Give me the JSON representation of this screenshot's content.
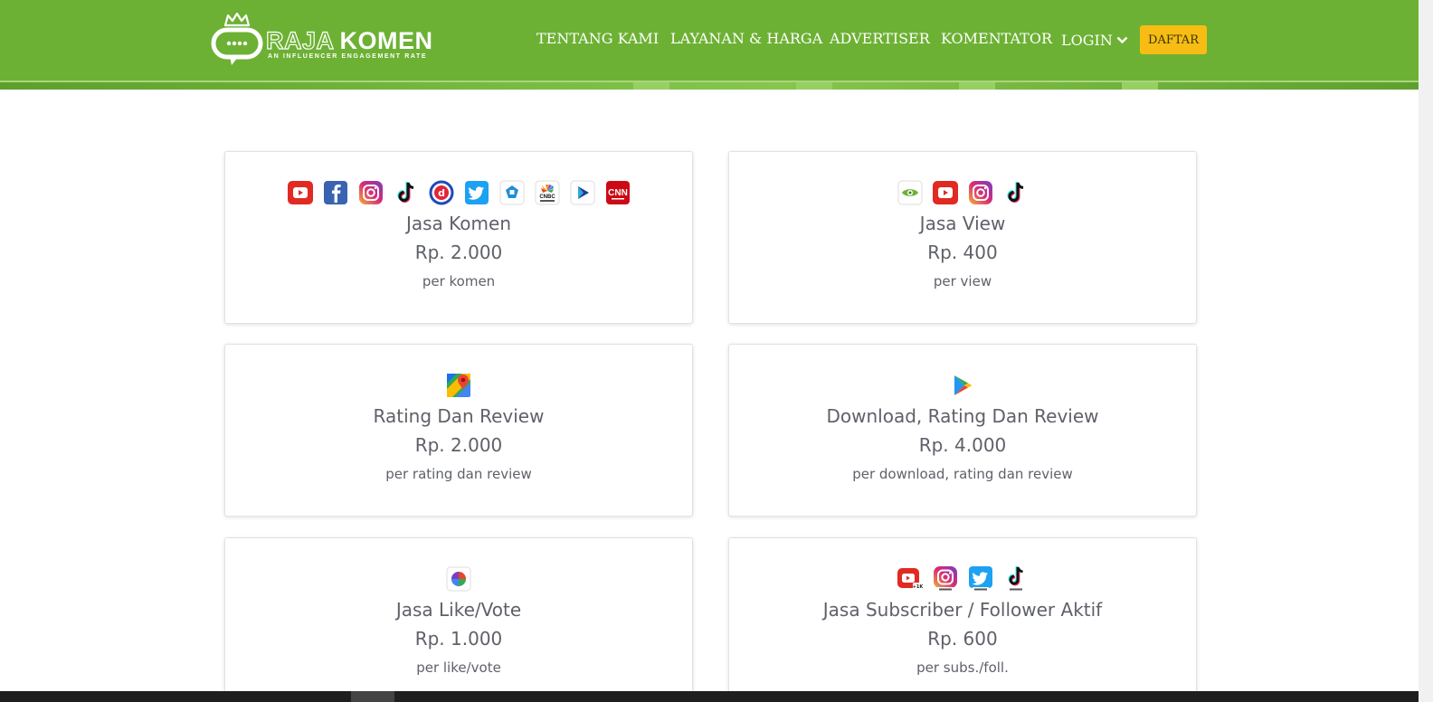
{
  "brand": {
    "name_part1": "RAJA",
    "name_part2": "KOMEN",
    "tagline": "AN INFLUENCER ENGAGEMENT RATE"
  },
  "nav": {
    "items": [
      "TENTANG KAMI",
      "LAYANAN & HARGA",
      "ADVERTISER",
      "KOMENTATOR"
    ],
    "login": "LOGIN",
    "signup": "DAFTAR"
  },
  "services": [
    {
      "title": "Jasa Komen",
      "price": "Rp. 2.000",
      "unit": "per komen",
      "icons": [
        "youtube-icon",
        "facebook-icon",
        "instagram-icon",
        "tiktok-icon",
        "detik-icon",
        "twitter-icon",
        "kompas-icon",
        "cnbc-icon",
        "play-news-icon",
        "cnn-icon"
      ]
    },
    {
      "title": "Jasa View",
      "price": "Rp. 400",
      "unit": "per view",
      "icons": [
        "eye-icon",
        "youtube-icon",
        "instagram-icon",
        "tiktok-icon"
      ]
    },
    {
      "title": "Rating Dan Review",
      "price": "Rp. 2.000",
      "unit": "per rating dan review",
      "icons": [
        "google-maps-icon"
      ]
    },
    {
      "title": "Download, Rating Dan Review",
      "price": "Rp. 4.000",
      "unit": "per download, rating dan review",
      "icons": [
        "google-play-icon"
      ]
    },
    {
      "title": "Jasa Like/Vote",
      "price": "Rp. 1.000",
      "unit": "per like/vote",
      "icons": [
        "like-vote-icon"
      ]
    },
    {
      "title": "Jasa Subscriber / Follower Aktif",
      "price": "Rp. 600",
      "unit": "per subs./foll.",
      "icons": [
        "youtube-subscribe-icon",
        "instagram-follow-icon",
        "twitter-follow-icon",
        "tiktok-follow-icon"
      ]
    }
  ],
  "colors": {
    "header_green": "#6db134",
    "button_yellow": "#f7bd14",
    "text_gray": "#5f6169"
  }
}
